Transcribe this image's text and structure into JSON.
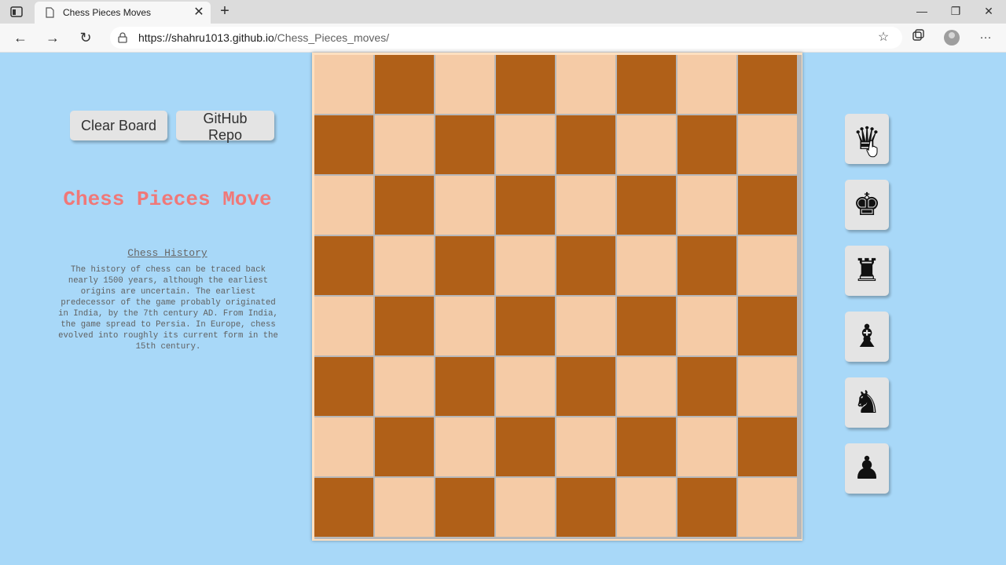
{
  "browser": {
    "tab_title": "Chess Pieces Moves",
    "tab_close": "✕",
    "new_tab": "+",
    "url_host": "https://shahru1013.github.io",
    "url_path": "/Chess_Pieces_moves/",
    "window_controls": {
      "minimize": "—",
      "restore": "❐",
      "close": "✕"
    },
    "nav": {
      "back": "←",
      "forward": "→",
      "reload": "↻"
    }
  },
  "page": {
    "buttons": {
      "clear": "Clear Board",
      "github": "GitHub Repo"
    },
    "title": "Chess Pieces Move",
    "subtitle": "Chess History",
    "history": "The history of chess can be traced back nearly 1500 years, although the earliest origins are uncertain. The earliest predecessor of the game probably originated in India, by the 7th century AD. From India, the game spread to Persia. In Europe, chess evolved into roughly its current form in the 15th century."
  },
  "board": {
    "rows": 8,
    "cols": 8,
    "top_left_color": "light",
    "colors": {
      "light": "#f5cba6",
      "dark": "#b06018"
    }
  },
  "pieces": [
    {
      "name": "queen",
      "glyph": "♛",
      "icon": "queen-icon"
    },
    {
      "name": "king",
      "glyph": "♚",
      "icon": "king-icon"
    },
    {
      "name": "rook",
      "glyph": "♜",
      "icon": "rook-icon"
    },
    {
      "name": "bishop",
      "glyph": "♝",
      "icon": "bishop-icon"
    },
    {
      "name": "knight",
      "glyph": "♞",
      "icon": "knight-icon"
    },
    {
      "name": "pawn",
      "glyph": "♟",
      "icon": "pawn-icon"
    }
  ],
  "colors": {
    "page_bg": "#a8d8f8",
    "title": "#f07878"
  }
}
